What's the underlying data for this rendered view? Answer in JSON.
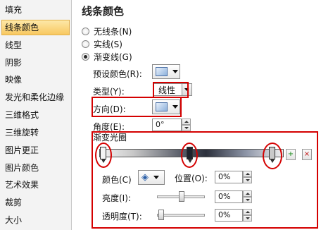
{
  "sidebar": {
    "items": [
      {
        "label": "填充",
        "selected": false
      },
      {
        "label": "线条颜色",
        "selected": true
      },
      {
        "label": "线型",
        "selected": false
      },
      {
        "label": "阴影",
        "selected": false
      },
      {
        "label": "映像",
        "selected": false
      },
      {
        "label": "发光和柔化边缘",
        "selected": false
      },
      {
        "label": "三维格式",
        "selected": false
      },
      {
        "label": "三维旋转",
        "selected": false
      },
      {
        "label": "图片更正",
        "selected": false
      },
      {
        "label": "图片颜色",
        "selected": false
      },
      {
        "label": "艺术效果",
        "selected": false
      },
      {
        "label": "裁剪",
        "selected": false
      },
      {
        "label": "大小",
        "selected": false
      }
    ]
  },
  "main": {
    "title": "线条颜色",
    "radio_options": [
      {
        "label": "无线条(N)",
        "checked": false
      },
      {
        "label": "实线(S)",
        "checked": false
      },
      {
        "label": "渐变线(G)",
        "checked": true
      }
    ],
    "preset_colors_label": "预设颜色(R):",
    "type_label": "类型(Y):",
    "type_value": "线性",
    "direction_label": "方向(D):",
    "angle_label": "角度(E):",
    "angle_value": "0°",
    "gradient_stops_label": "渐变光圈",
    "color_label": "颜色(C)",
    "position_label": "位置(O):",
    "position_value": "0%",
    "brightness_label": "亮度(I):",
    "brightness_value": "0%",
    "transparency_label": "透明度(T):",
    "transparency_value": "0%"
  },
  "icons": {
    "add_stop": "add-gradient-stop-icon",
    "remove_stop": "remove-gradient-stop-icon",
    "paint_bucket": "paint-bucket-icon"
  },
  "colors": {
    "annotation_red": "#d40000",
    "selected_bg": "#f8c860",
    "swatch_blue": "#8eb2dc"
  }
}
